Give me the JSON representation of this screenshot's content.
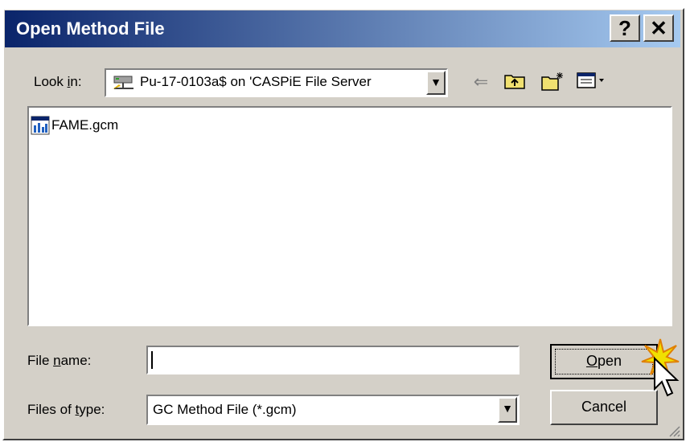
{
  "dialog": {
    "title": "Open Method File",
    "help_button": "?",
    "close_button": "✕"
  },
  "look_in": {
    "label_pre": "Look ",
    "label_mnemonic": "i",
    "label_post": "n:",
    "value": "Pu-17-0103a$ on 'CASPiE File Server"
  },
  "toolbar": {
    "back_icon": "back-arrow-icon",
    "up_icon": "up-folder-icon",
    "new_folder_icon": "new-folder-icon",
    "view_icon": "view-menu-icon"
  },
  "files": [
    {
      "name": "FAME.gcm",
      "icon": "gc-method-file-icon"
    }
  ],
  "file_name": {
    "label_pre": "File ",
    "label_mnemonic": "n",
    "label_post": "ame:",
    "value": ""
  },
  "file_type": {
    "label_pre": "Files of ",
    "label_mnemonic": "t",
    "label_post": "ype:",
    "value": "GC Method File (*.gcm)"
  },
  "buttons": {
    "open_mnemonic": "O",
    "open_rest": "pen",
    "cancel": "Cancel"
  },
  "colors": {
    "titlebar_start": "#0a246a",
    "titlebar_end": "#a6caf0",
    "face": "#d4d0c8"
  }
}
